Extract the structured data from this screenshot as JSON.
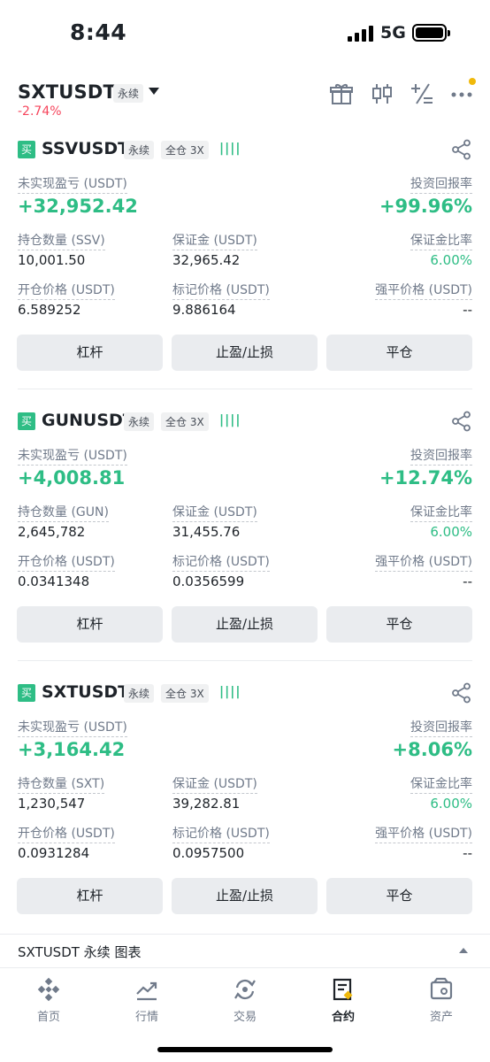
{
  "status": {
    "time": "8:44",
    "network": "5G"
  },
  "header": {
    "pair": "SXTUSDT",
    "type": "永续",
    "change": "-2.74%"
  },
  "labels": {
    "pnl": "未实现盈亏 (USDT)",
    "roi": "投资回报率",
    "margin": "保证金 (USDT)",
    "margin_ratio": "保证金比率",
    "entry": "开仓价格 (USDT)",
    "mark": "标记价格 (USDT)",
    "liq": "强平价格 (USDT)",
    "btn_leverage": "杠杆",
    "btn_tpsl": "止盈/止损",
    "btn_close": "平仓",
    "buy": "买",
    "perp": "永续",
    "cross": "全仓 3X"
  },
  "positions": [
    {
      "symbol": "SSVUSDT",
      "pnl": "+32,952.42",
      "roi": "+99.96%",
      "size_label": "持仓数量 (SSV)",
      "size": "10,001.50",
      "margin": "32,965.42",
      "margin_ratio": "6.00%",
      "entry": "6.589252",
      "mark": "9.886164",
      "liq": "--"
    },
    {
      "symbol": "GUNUSDT",
      "pnl": "+4,008.81",
      "roi": "+12.74%",
      "size_label": "持仓数量 (GUN)",
      "size": "2,645,782",
      "margin": "31,455.76",
      "margin_ratio": "6.00%",
      "entry": "0.0341348",
      "mark": "0.0356599",
      "liq": "--"
    },
    {
      "symbol": "SXTUSDT",
      "pnl": "+3,164.42",
      "roi": "+8.06%",
      "size_label": "持仓数量 (SXT)",
      "size": "1,230,547",
      "margin": "39,282.81",
      "margin_ratio": "6.00%",
      "entry": "0.0931284",
      "mark": "0.0957500",
      "liq": "--"
    }
  ],
  "chart_bar": {
    "label": "SXTUSDT 永续  图表"
  },
  "nav": [
    {
      "label": "首页",
      "icon": "home-icon"
    },
    {
      "label": "行情",
      "icon": "markets-icon"
    },
    {
      "label": "交易",
      "icon": "trade-icon"
    },
    {
      "label": "合约",
      "icon": "futures-icon"
    },
    {
      "label": "资产",
      "icon": "wallet-icon"
    }
  ],
  "colors": {
    "green": "#2ebd85",
    "red": "#f6465d",
    "yellow": "#f0b90b"
  }
}
